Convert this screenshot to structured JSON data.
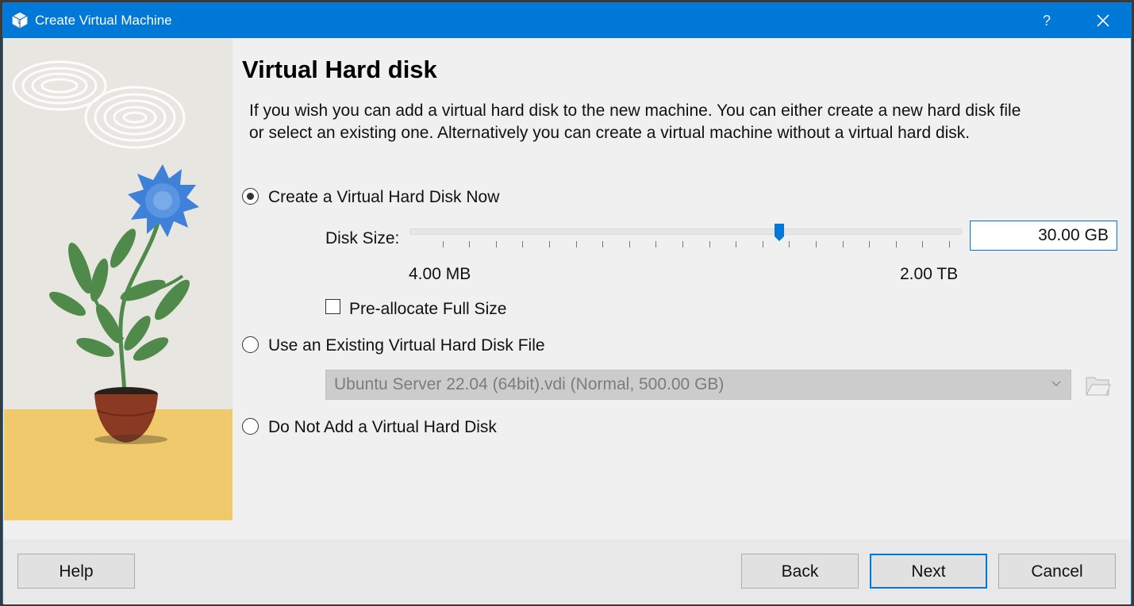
{
  "window": {
    "title": "Create Virtual Machine",
    "help_glyph": "?",
    "icon": "virtualbox-cube-icon"
  },
  "page": {
    "heading": "Virtual Hard disk",
    "description": "If you wish you can add a virtual hard disk to the new machine. You can either create a new hard disk file or select an existing one. Alternatively you can create a virtual machine without a virtual hard disk."
  },
  "options": {
    "create_new": {
      "label": "Create a Virtual Hard Disk Now",
      "selected": true
    },
    "use_existing": {
      "label": "Use an Existing Virtual Hard Disk File",
      "selected": false
    },
    "no_disk": {
      "label": "Do Not Add a Virtual Hard Disk",
      "selected": false
    }
  },
  "disk_size": {
    "label": "Disk Size:",
    "value": "30.00",
    "unit": "GB",
    "min_label": "4.00 MB",
    "max_label": "2.00 TB",
    "slider_position_fraction": 0.67,
    "tick_count": 20
  },
  "preallocate": {
    "label": "Pre-allocate Full Size",
    "checked": false
  },
  "existing_disk": {
    "selected": "Ubuntu Server 22.04 (64bit).vdi (Normal, 500.00 GB)",
    "enabled": false,
    "browse_icon": "folder-icon"
  },
  "buttons": {
    "help": "Help",
    "back": "Back",
    "next": "Next",
    "cancel": "Cancel"
  },
  "colors": {
    "titlebar": "#0078d7",
    "accent": "#0078d7",
    "illustration_bg": "#e8e6e1",
    "illustration_floor": "#efc96b",
    "flower": "#3f80d8",
    "leaves": "#4f8a4a",
    "pot": "#8a3a22"
  }
}
